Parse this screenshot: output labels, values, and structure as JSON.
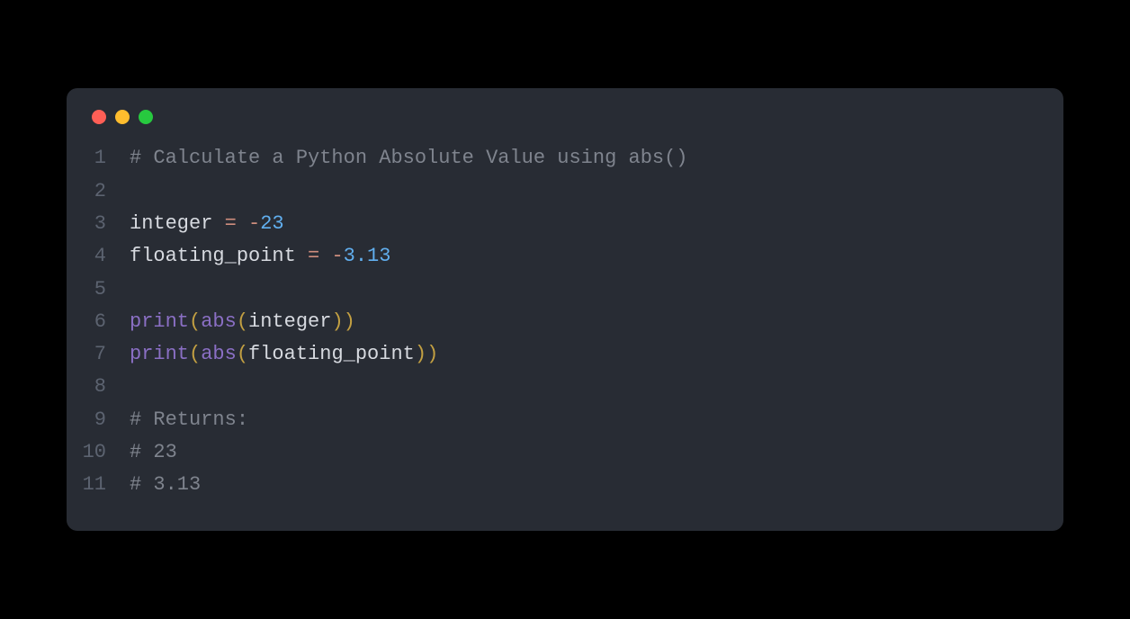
{
  "windowControls": {
    "close": "close",
    "minimize": "minimize",
    "maximize": "maximize"
  },
  "code": {
    "lines": [
      {
        "num": "1",
        "tokens": [
          {
            "cls": "tok-comment",
            "text": "# Calculate a Python Absolute Value using abs()"
          }
        ]
      },
      {
        "num": "2",
        "tokens": []
      },
      {
        "num": "3",
        "tokens": [
          {
            "cls": "tok-default",
            "text": "integer "
          },
          {
            "cls": "tok-operator",
            "text": "="
          },
          {
            "cls": "tok-default",
            "text": " "
          },
          {
            "cls": "tok-operator",
            "text": "-"
          },
          {
            "cls": "tok-number",
            "text": "23"
          }
        ]
      },
      {
        "num": "4",
        "tokens": [
          {
            "cls": "tok-default",
            "text": "floating_point "
          },
          {
            "cls": "tok-operator",
            "text": "="
          },
          {
            "cls": "tok-default",
            "text": " "
          },
          {
            "cls": "tok-operator",
            "text": "-"
          },
          {
            "cls": "tok-number",
            "text": "3.13"
          }
        ]
      },
      {
        "num": "5",
        "tokens": []
      },
      {
        "num": "6",
        "tokens": [
          {
            "cls": "tok-function",
            "text": "print"
          },
          {
            "cls": "tok-paren",
            "text": "("
          },
          {
            "cls": "tok-function",
            "text": "abs"
          },
          {
            "cls": "tok-paren",
            "text": "("
          },
          {
            "cls": "tok-default",
            "text": "integer"
          },
          {
            "cls": "tok-paren",
            "text": "))"
          }
        ]
      },
      {
        "num": "7",
        "tokens": [
          {
            "cls": "tok-function",
            "text": "print"
          },
          {
            "cls": "tok-paren",
            "text": "("
          },
          {
            "cls": "tok-function",
            "text": "abs"
          },
          {
            "cls": "tok-paren",
            "text": "("
          },
          {
            "cls": "tok-default",
            "text": "floating_point"
          },
          {
            "cls": "tok-paren",
            "text": "))"
          }
        ]
      },
      {
        "num": "8",
        "tokens": []
      },
      {
        "num": "9",
        "tokens": [
          {
            "cls": "tok-comment",
            "text": "# Returns:"
          }
        ]
      },
      {
        "num": "10",
        "tokens": [
          {
            "cls": "tok-comment",
            "text": "# 23"
          }
        ]
      },
      {
        "num": "11",
        "tokens": [
          {
            "cls": "tok-comment",
            "text": "# 3.13"
          }
        ]
      }
    ]
  }
}
